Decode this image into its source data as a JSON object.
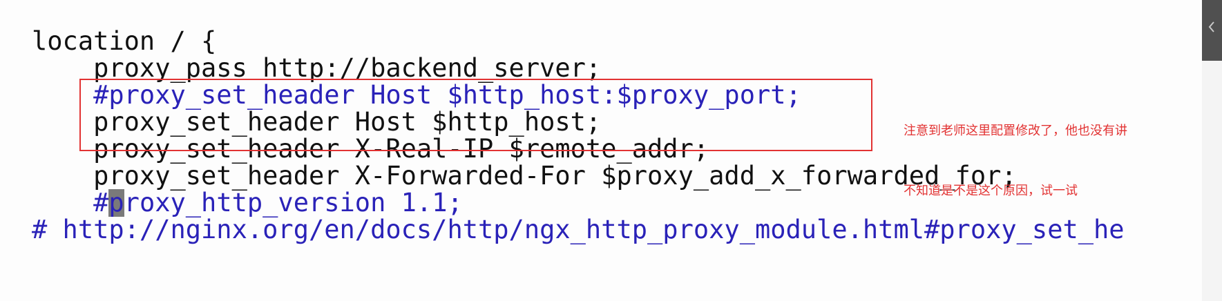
{
  "editor": {
    "lines": [
      "location / {",
      "    proxy_pass http://backend_server;",
      "    #proxy_set_header Host $http_host:$proxy_port;",
      "    proxy_set_header Host $http_host;",
      "    proxy_set_header X-Real-IP $remote_addr;",
      "    proxy_set_header X-Forwarded-For $proxy_add_x_forwarded_for;",
      "#proxy_http_version 1.1;",
      "# http://nginx.org/en/docs/http/ngx_http_proxy_module.html#proxy_set_he"
    ],
    "cursor_line_prefix": "    #",
    "cursor_char": "p",
    "cursor_line_suffix": "roxy_http_version 1.1;"
  },
  "annotation": {
    "line1": "注意到老师这里配置修改了，他也没有讲",
    "line2": "不知道是不是这个原因，试一试"
  },
  "colors": {
    "comment": "#2a22b8",
    "code": "#111111",
    "annotation": "#e23232",
    "cursor": "#7a7a7a"
  },
  "icons": {
    "scroll": "chevron-left-icon"
  }
}
